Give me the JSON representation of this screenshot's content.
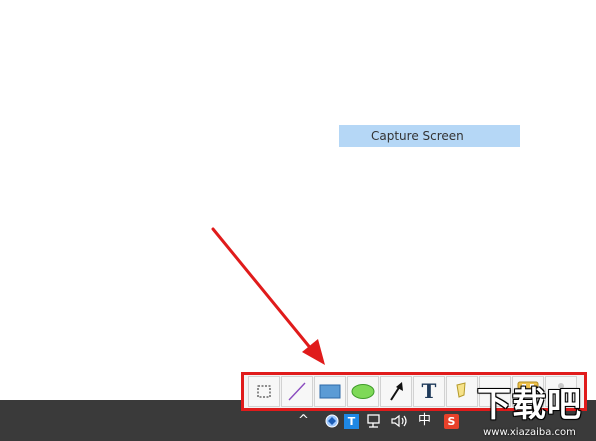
{
  "context_menu": {
    "item_label": "Capture Screen"
  },
  "taskbar": {
    "tray": {
      "chevron_glyph": "^",
      "t_app_label": "T",
      "network_glyph": "▭",
      "volume_glyph": "🔈",
      "ime_label": "中",
      "sogou_label": "S"
    }
  },
  "toolbar": {
    "tools": [
      {
        "name": "select-region"
      },
      {
        "name": "line"
      },
      {
        "name": "rectangle"
      },
      {
        "name": "ellipse"
      },
      {
        "name": "arrow"
      },
      {
        "name": "text",
        "label": "T"
      },
      {
        "name": "highlighter"
      },
      {
        "name": "blank"
      },
      {
        "name": "copy"
      },
      {
        "name": "more"
      }
    ]
  },
  "watermark": {
    "brand_text": "下载吧",
    "url_text": "www.xiazaiba.com"
  },
  "colors": {
    "annotation_red": "#e01b1b",
    "selection_blue": "#b5d7f6",
    "taskbar": "#3a3a3a"
  }
}
